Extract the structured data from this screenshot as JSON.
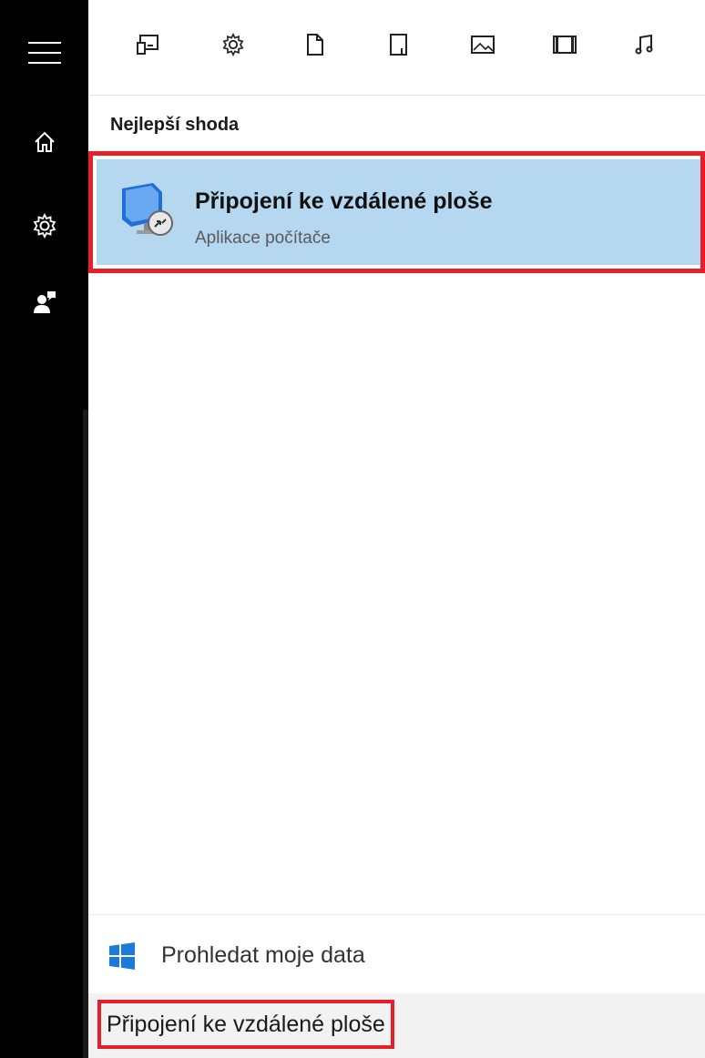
{
  "colors": {
    "rail": "#000000",
    "highlight": "#b6d7f0",
    "annotation_red": "#e5202b"
  },
  "rail": {
    "items": [
      {
        "icon": "hamburger-menu-icon"
      },
      {
        "icon": "home-icon"
      },
      {
        "icon": "settings-gear-icon"
      },
      {
        "icon": "feedback-person-icon"
      }
    ]
  },
  "filters": [
    {
      "icon": "apps-icon"
    },
    {
      "icon": "settings-icon"
    },
    {
      "icon": "documents-icon"
    },
    {
      "icon": "folders-icon"
    },
    {
      "icon": "photos-icon"
    },
    {
      "icon": "videos-icon"
    },
    {
      "icon": "music-icon"
    }
  ],
  "results": {
    "section_title": "Nejlepší shoda",
    "best_match": {
      "title": "Připojení ke vzdálené ploše",
      "subtitle": "Aplikace počítače",
      "icon": "remote-desktop-icon"
    }
  },
  "footer": {
    "search_mine_label": "Prohledat moje data",
    "search_mine_icon": "windows-logo-icon",
    "query": "Připojení ke vzdálené ploše"
  }
}
